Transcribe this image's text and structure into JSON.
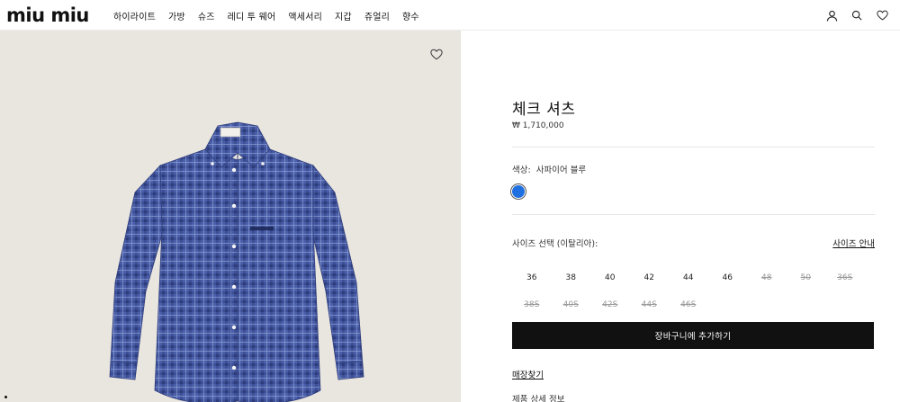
{
  "header": {
    "logo_text": "miu miu",
    "nav": [
      "하이라이트",
      "가방",
      "슈즈",
      "레디 투 웨어",
      "액세서리",
      "지갑",
      "쥬얼리",
      "향수"
    ],
    "icons": [
      "user-icon",
      "search-icon",
      "heart-icon"
    ]
  },
  "gallery": {
    "wishlist_icon": "heart-outline-icon",
    "image_subject": "blue check button-down shirt",
    "colors": {
      "background": "#e9e5df",
      "shirt_base": "#4a5fa8",
      "shirt_dark": "#2e3d7a",
      "shirt_light": "#8fa0d6"
    }
  },
  "product": {
    "title": "체크 셔츠",
    "price": "₩ 1,710,000",
    "color_label": "색상:",
    "color_value": "사파이어 블루",
    "swatch_color": "#1f6fe0",
    "size_label": "사이즈 선택 (이탈리아):",
    "size_guide": "사이즈 안내",
    "sizes": [
      [
        {
          "label": "36",
          "available": true
        },
        {
          "label": "38",
          "available": true
        },
        {
          "label": "40",
          "available": true
        },
        {
          "label": "42",
          "available": true
        },
        {
          "label": "44",
          "available": true
        },
        {
          "label": "46",
          "available": true
        },
        {
          "label": "48",
          "available": false
        },
        {
          "label": "50",
          "available": false
        },
        {
          "label": "36S",
          "available": false
        }
      ],
      [
        {
          "label": "38S",
          "available": false
        },
        {
          "label": "40S",
          "available": false
        },
        {
          "label": "42S",
          "available": false
        },
        {
          "label": "44S",
          "available": false
        },
        {
          "label": "46S",
          "available": false
        }
      ]
    ],
    "add_to_cart": "장바구니에 추가하기",
    "store_finder": "매장찾기",
    "product_info": "제품 상세 정보"
  }
}
